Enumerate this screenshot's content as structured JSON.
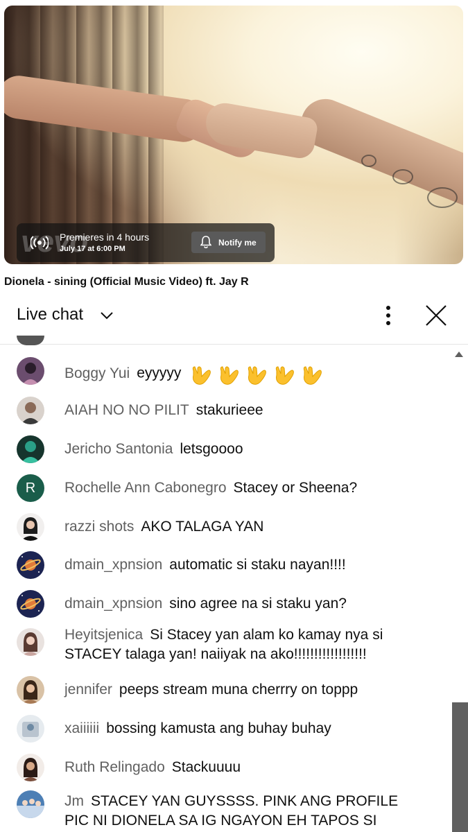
{
  "video": {
    "watermark": "vevo",
    "premiere_title": "Premieres in 4 hours",
    "premiere_date": "July 17 at 6:00 PM",
    "notify_label": "Notify me",
    "title": "Dionela - sining (Official Music Video) ft. Jay R"
  },
  "chat": {
    "header_label": "Live chat",
    "messages": [
      {
        "author": "Boggy Yui",
        "text": "eyyyyy",
        "avatar_color": "#6b4d6e"
      },
      {
        "author": "AIAH NO NO PILIT",
        "text": "stakurieee",
        "avatar_color": "#8a7a70"
      },
      {
        "author": "Jericho Santonia",
        "text": "letsgoooo",
        "avatar_color": "#1f6d5c"
      },
      {
        "author": "Rochelle Ann Cabonegro",
        "text": "Stacey or Sheena?",
        "avatar_color": "#1a5d4a",
        "avatar_letter": "R"
      },
      {
        "author": "razzi shots",
        "text": "AKO TALAGA YAN",
        "avatar_color": "#2b2b2b"
      },
      {
        "author": "dmain_xpnsion",
        "text": "automatic si staku nayan!!!!",
        "avatar_color": "#1c2452"
      },
      {
        "author": "dmain_xpnsion",
        "text": "sino agree na si staku yan?",
        "avatar_color": "#1c2452"
      },
      {
        "author": "Heyitsjenica",
        "text": "Si Stacey yan alam ko kamay nya si STACEY talaga yan! naiiyak na ako!!!!!!!!!!!!!!!!!!",
        "avatar_color": "#c9a6a0"
      },
      {
        "author": "jennifer",
        "text": "peeps stream muna cherrry on toppp",
        "avatar_color": "#a87a55"
      },
      {
        "author": "xaiiiiii",
        "text": "bossing kamusta ang buhay buhay",
        "avatar_color": "#b9c4cf"
      },
      {
        "author": "Ruth Relingado",
        "text": "Stackuuuu",
        "avatar_color": "#7a4e3c"
      },
      {
        "author": "Jm",
        "text": "STACEY YAN GUYSSSS. PINK ANG PROFILE PIC NI DIONELA SA IG NGAYON EH TAPOS SI",
        "avatar_color": "#4d7fb5"
      }
    ]
  }
}
